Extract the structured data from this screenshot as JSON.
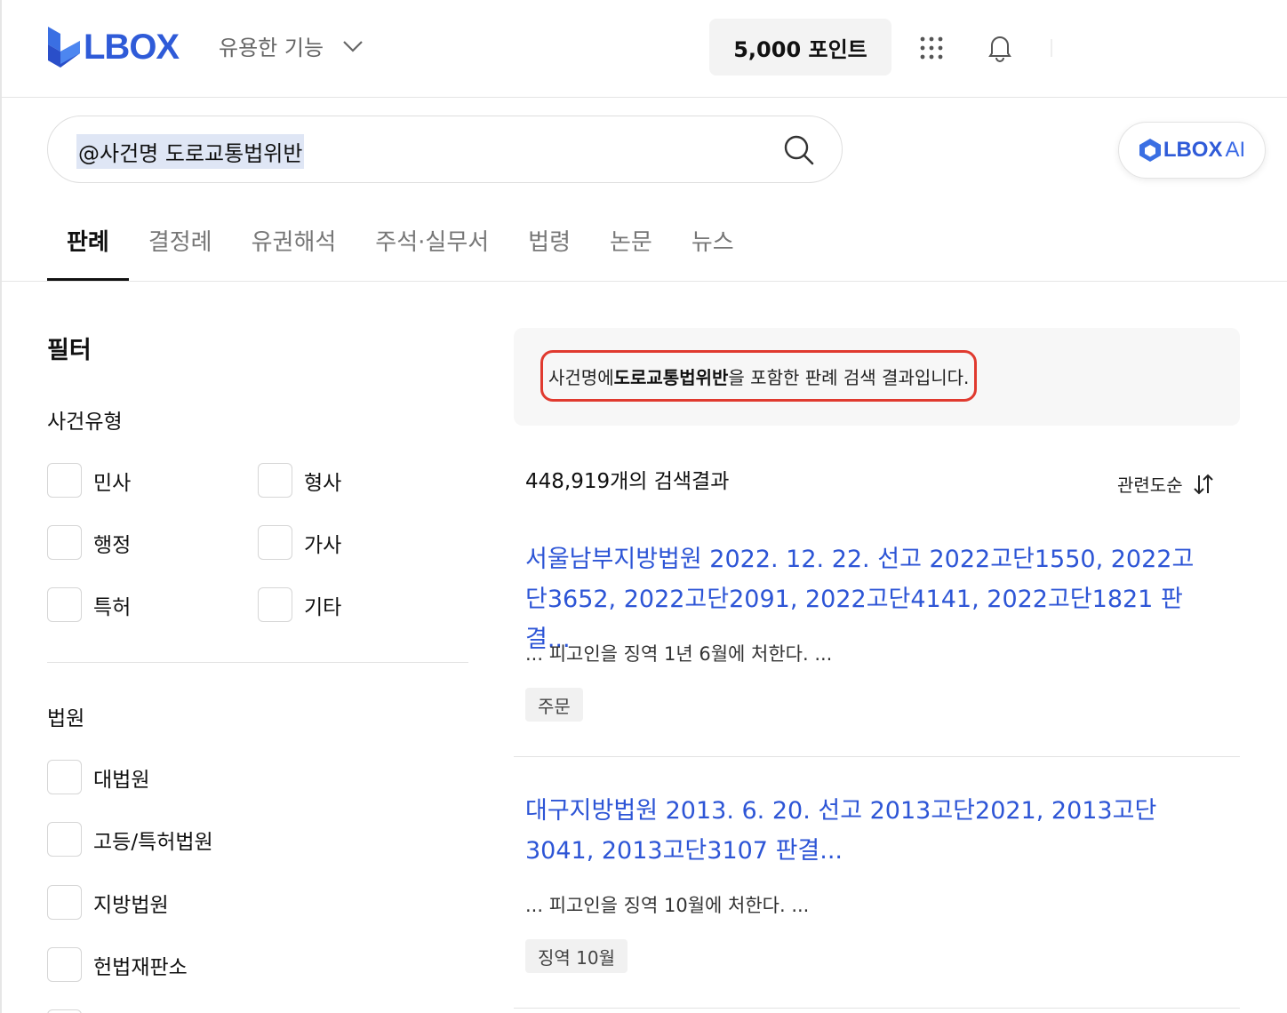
{
  "header": {
    "brand": "LBOX",
    "features_label": "유용한 기능",
    "points_label": "5,000 포인트"
  },
  "search": {
    "query": "@사건명 도로교통법위반"
  },
  "ai_button": {
    "brand": "LBOX",
    "suffix": "AI"
  },
  "tabs": [
    {
      "label": "판례"
    },
    {
      "label": "결정례"
    },
    {
      "label": "유권해석"
    },
    {
      "label": "주석·실무서"
    },
    {
      "label": "법령"
    },
    {
      "label": "논문"
    },
    {
      "label": "뉴스"
    }
  ],
  "filter": {
    "title": "필터",
    "case_type": {
      "title": "사건유형",
      "options": [
        "민사",
        "형사",
        "행정",
        "가사",
        "특허",
        "기타"
      ]
    },
    "court": {
      "title": "법원",
      "options": [
        "대법원",
        "고등/특허법원",
        "지방법원",
        "헌법재판소"
      ]
    }
  },
  "notice": {
    "prefix": "사건명에 ",
    "keyword": "도로교통법위반",
    "suffix": "을 포함한 판례 검색 결과입니다."
  },
  "results_count": "448,919개의 검색결과",
  "sort_label": "관련도순",
  "results": [
    {
      "title": "서울남부지방법원 2022. 12. 22. 선고 2022고단1550, 2022고단3652, 2022고단2091, 2022고단4141, 2022고단1821 판결...",
      "snippet": "... 피고인을 징역 1년 6월에 처한다. ...",
      "tag": "주문"
    },
    {
      "title": "대구지방법원 2013. 6. 20. 선고 2013고단2021, 2013고단3041, 2013고단3107 판결...",
      "snippet": "... 피고인을 징역 10월에 처한다. ...",
      "tag": "징역 10월"
    }
  ],
  "colors": {
    "brand": "#2f5bd8",
    "link": "#2d55d6",
    "highlight_border": "#e03a2f"
  }
}
